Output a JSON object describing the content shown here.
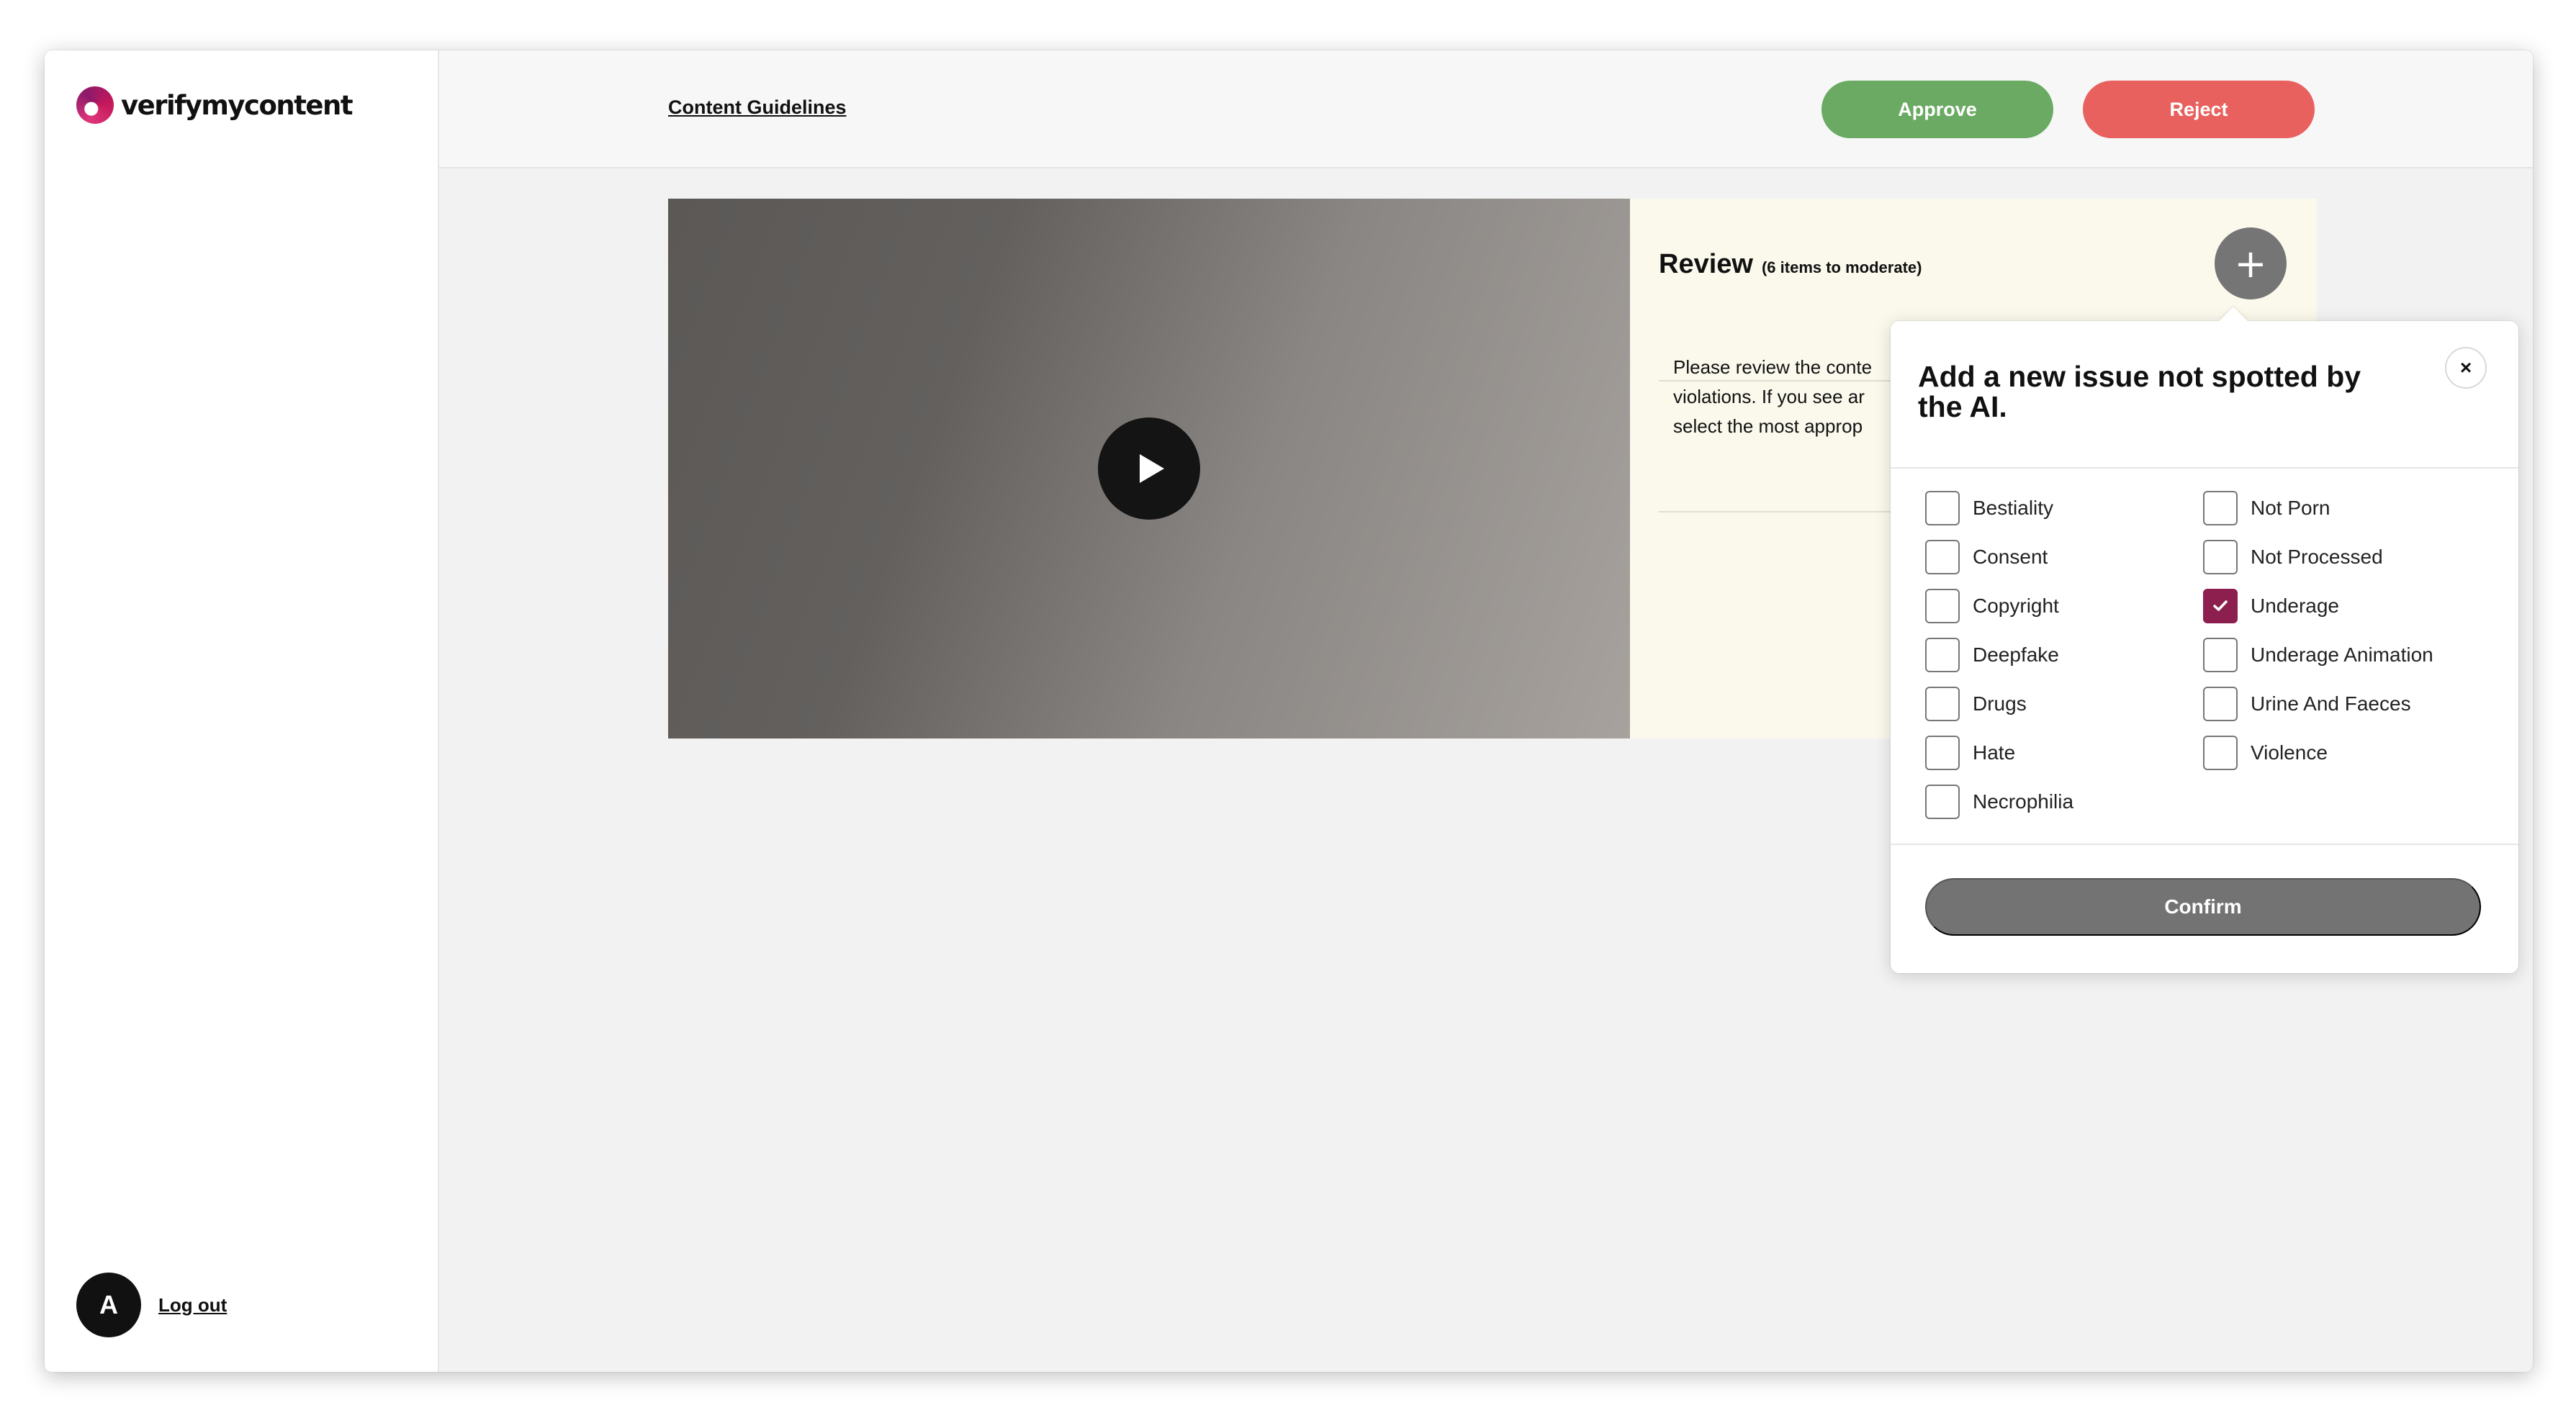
{
  "brand": {
    "name": "verifymycontent",
    "icon": "verifymycontent-logo-icon"
  },
  "user": {
    "avatar_initial": "A",
    "logout_label": "Log out"
  },
  "header": {
    "guidelines_link": "Content Guidelines",
    "approve_label": "Approve",
    "reject_label": "Reject",
    "approve_color": "#6aaa62",
    "reject_color": "#e8615e"
  },
  "video": {
    "play_icon": "play-icon"
  },
  "review": {
    "title": "Review",
    "subtitle": "(6 items to moderate)",
    "add_icon": "+",
    "instructions": [
      "Please review the conte",
      "violations. If you see ar",
      "select the most approp"
    ]
  },
  "popover": {
    "title": "Add a new issue not spotted by the AI.",
    "close_icon": "×",
    "confirm_label": "Confirm",
    "accent_color": "#8c1f4e",
    "options_left": [
      {
        "label": "Bestiality",
        "checked": false
      },
      {
        "label": "Consent",
        "checked": false
      },
      {
        "label": "Copyright",
        "checked": false
      },
      {
        "label": "Deepfake",
        "checked": false
      },
      {
        "label": "Drugs",
        "checked": false
      },
      {
        "label": "Hate",
        "checked": false
      },
      {
        "label": "Necrophilia",
        "checked": false
      }
    ],
    "options_right": [
      {
        "label": "Not Porn",
        "checked": false
      },
      {
        "label": "Not Processed",
        "checked": false
      },
      {
        "label": "Underage",
        "checked": true
      },
      {
        "label": "Underage Animation",
        "checked": false
      },
      {
        "label": "Urine And Faeces",
        "checked": false
      },
      {
        "label": "Violence",
        "checked": false
      }
    ]
  }
}
